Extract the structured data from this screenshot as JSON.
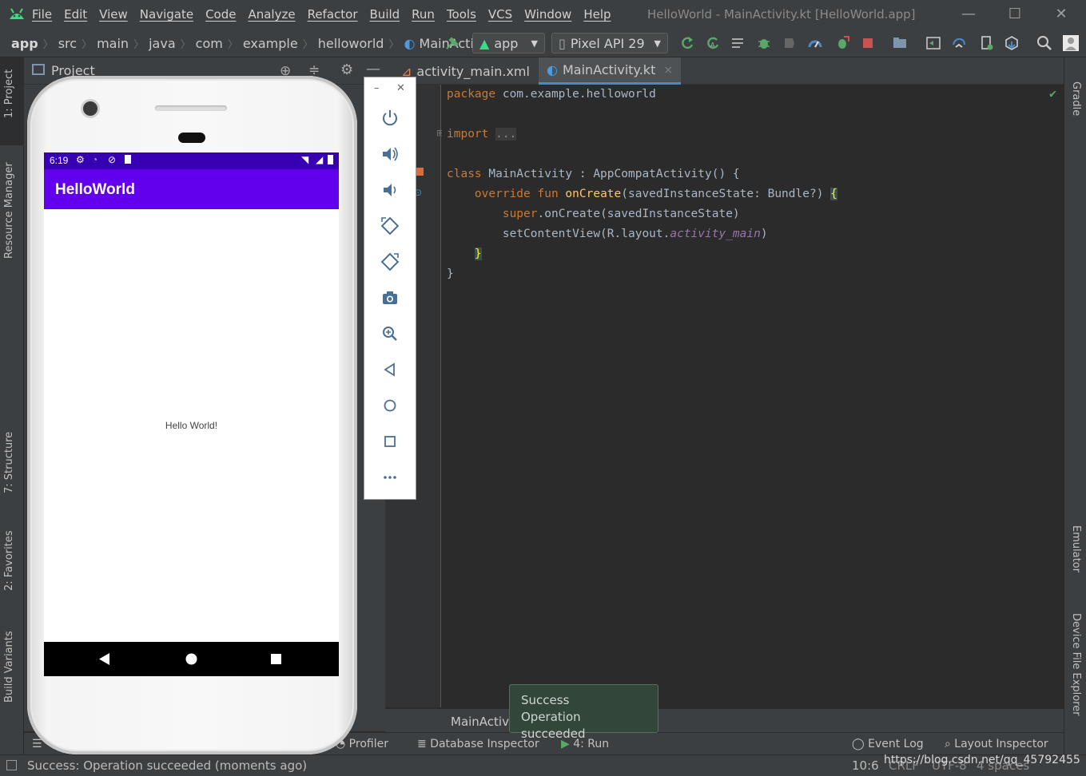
{
  "menu": [
    "File",
    "Edit",
    "View",
    "Navigate",
    "Code",
    "Analyze",
    "Refactor",
    "Build",
    "Run",
    "Tools",
    "VCS",
    "Window",
    "Help"
  ],
  "window_title": "HelloWorld - MainActivity.kt [HelloWorld.app]",
  "breadcrumb": [
    "app",
    "src",
    "main",
    "java",
    "com",
    "example",
    "helloworld",
    "MainActivi"
  ],
  "run_config": "app",
  "device": "Pixel API 29",
  "project_panel": {
    "title": "Project"
  },
  "editor_tabs": [
    {
      "label": "activity_main.xml",
      "close": "×"
    },
    {
      "label": "MainActivity.kt",
      "close": "×"
    }
  ],
  "code": {
    "package_kw": "package",
    "package_name": " com.example.helloworld",
    "import_kw": "import",
    "import_fold": "...",
    "class_kw": "class",
    "class_rest": " MainActivity : AppCompatActivity() {",
    "override_kw": "override fun",
    "fn_name": "onCreate",
    "fn_params": "(savedInstanceState: Bundle?) ",
    "open_brace": "{",
    "super_kw": "super",
    "super_rest": ".onCreate(savedInstanceState)",
    "setcv_pre": "setContentView(R.layout.",
    "setcv_it": "activity_main",
    "setcv_post": ")",
    "close_inner": "}",
    "close_outer": "}"
  },
  "editor_footer": "MainActivi",
  "balloon": {
    "title": "Success",
    "message": "Operation succeeded"
  },
  "bottom_tools": {
    "profiler": "Profiler",
    "database": "Database Inspector",
    "run": "4: Run",
    "event_log": "Event Log",
    "layout_inspector": "Layout Inspector"
  },
  "status": {
    "message": "Success: Operation succeeded (moments ago)",
    "position": "10:6",
    "line_sep": "CRLF",
    "encoding": "UTF-8",
    "indent": "4 spaces",
    "watermark": "https://blog.csdn.net/qq_45792455"
  },
  "left_tabs": [
    "1: Project",
    "Resource Manager",
    "7: Structure",
    "2: Favorites",
    "Build Variants"
  ],
  "right_tabs": [
    "Gradle",
    "Emulator",
    "Device File Explorer"
  ],
  "phone": {
    "time": "6:19",
    "app_title": "HelloWorld",
    "content_text": "Hello World!"
  },
  "emulator_controls": [
    "power-icon",
    "volume-up-icon",
    "volume-down-icon",
    "rotate-left-icon",
    "rotate-right-icon",
    "camera-icon",
    "zoom-icon",
    "back-icon",
    "home-icon",
    "overview-icon",
    "more-icon"
  ],
  "colors": {
    "accent": "#4a88c7",
    "app_primary": "#6200ee",
    "app_status": "#3700b3",
    "keyword": "#cc7832",
    "function": "#ffc66d"
  }
}
